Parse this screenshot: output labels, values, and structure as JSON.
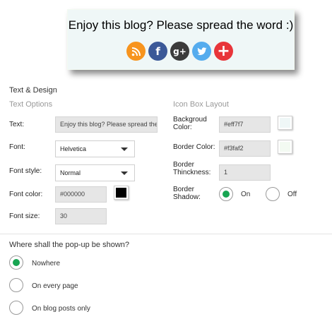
{
  "preview": {
    "title": "Enjoy this blog? Please spread the word :)",
    "icons": [
      {
        "name": "rss-icon",
        "glyph": "◥",
        "color": "#f7941e"
      },
      {
        "name": "facebook-icon",
        "glyph": "f",
        "color": "#3b5998"
      },
      {
        "name": "googleplus-icon",
        "glyph": "g+",
        "color": "#3b3b3b"
      },
      {
        "name": "twitter-icon",
        "glyph": "t",
        "color": "#55acee"
      },
      {
        "name": "plus-icon",
        "glyph": "+",
        "color": "#e8353a"
      }
    ]
  },
  "section": {
    "title": "Text & Design",
    "text_options": "Text Options",
    "icon_box_layout": "Icon Box Layout"
  },
  "text_options": {
    "text_label": "Text:",
    "text_value": "Enjoy this blog? Please spread the word :)",
    "font_label": "Font:",
    "font_value": "Helvetica",
    "font_style_label": "Font style:",
    "font_style_value": "Normal",
    "font_color_label": "Font color:",
    "font_color_value": "#000000",
    "font_size_label": "Font size:",
    "font_size_value": "30"
  },
  "icon_box": {
    "bg_label_1": "Backgroud",
    "bg_label_2": "Color:",
    "bg_value": "#eff7f7",
    "border_color_label": "Border Color:",
    "border_color_value": "#f3faf2",
    "border_thickness_label_1": "Border",
    "border_thickness_label_2": "Thinckness:",
    "border_thickness_value": "1",
    "border_shadow_label_1": "Border",
    "border_shadow_label_2": "Shadow:",
    "shadow_on": "On",
    "shadow_off": "Off",
    "shadow_selected": "On"
  },
  "show": {
    "question": "Where shall the pop-up be shown?",
    "options": [
      "Nowhere",
      "On every page",
      "On blog posts only"
    ],
    "selected": "Nowhere"
  },
  "colors": {
    "accent_green": "#17a552",
    "swatch_font": "#000000",
    "swatch_bg": "#eff7f7",
    "swatch_border": "#f3faf2"
  }
}
